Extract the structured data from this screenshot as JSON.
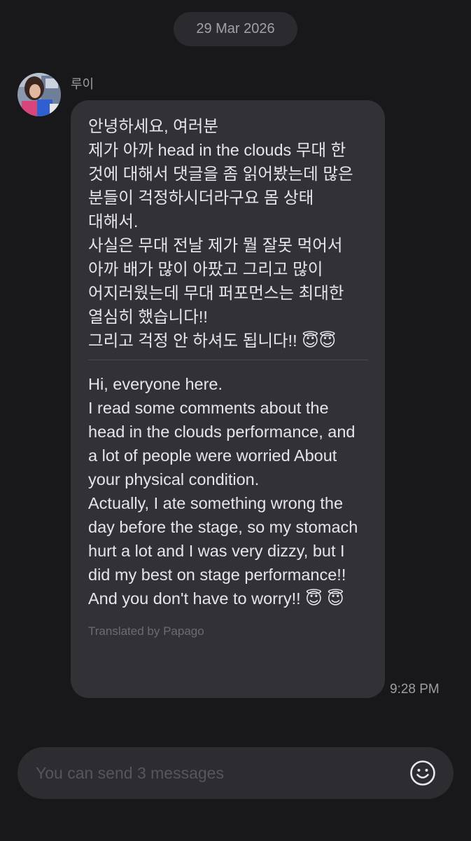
{
  "date_separator": "29 Mar 2026",
  "message": {
    "sender": "루이",
    "korean_text": "안녕하세요, 여러분\n제가 아까 head in the clouds 무대 한 것에 대해서 댓글을 좀 읽어봤는데 많은 분들이 걱정하시더라구요 몸 상태 대해서.\n사실은 무대 전날 제가 뭘 잘못 먹어서 아까 배가 많이 아팠고 그리고 많이 어지러웠는데 무대 퍼포먼스는 최대한 열심히 했습니다!!\n그리고 걱정 안 하셔도 됩니다!! 😇😇",
    "english_text": "Hi, everyone here.\nI read some comments about the head in the clouds performance, and a lot of people were worried About your physical condition.\nActually, I ate something wrong the day before the stage, so my stomach hurt a lot and I was very dizzy, but I did my best on stage performance!!\nAnd you don't have to worry!! 😇 😇",
    "translated_by": "Translated by Papago",
    "time": "9:28 PM"
  },
  "composer": {
    "placeholder": "You can send 3 messages",
    "value": ""
  },
  "colors": {
    "background": "#18181b",
    "bubble": "#313136",
    "date_pill": "#2a2a2f"
  },
  "icons": {
    "avatar": "profile-photo",
    "emoji": "smiley-face-icon"
  }
}
